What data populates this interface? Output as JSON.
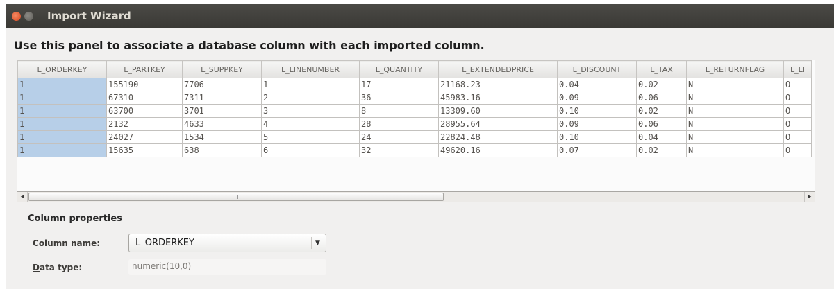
{
  "window": {
    "title": "Import Wizard"
  },
  "instruction": "Use this panel to associate a database column with each imported column.",
  "table": {
    "columns": [
      "L_ORDERKEY",
      "L_PARTKEY",
      "L_SUPPKEY",
      "L_LINENUMBER",
      "L_QUANTITY",
      "L_EXTENDEDPRICE",
      "L_DISCOUNT",
      "L_TAX",
      "L_RETURNFLAG",
      "L_LI"
    ],
    "rows": [
      [
        "1",
        "155190",
        "7706",
        "1",
        "17",
        "21168.23",
        "0.04",
        "0.02",
        "N",
        "O"
      ],
      [
        "1",
        "67310",
        "7311",
        "2",
        "36",
        "45983.16",
        "0.09",
        "0.06",
        "N",
        "O"
      ],
      [
        "1",
        "63700",
        "3701",
        "3",
        "8",
        "13309.60",
        "0.10",
        "0.02",
        "N",
        "O"
      ],
      [
        "1",
        "2132",
        "4633",
        "4",
        "28",
        "28955.64",
        "0.09",
        "0.06",
        "N",
        "O"
      ],
      [
        "1",
        "24027",
        "1534",
        "5",
        "24",
        "22824.48",
        "0.10",
        "0.04",
        "N",
        "O"
      ],
      [
        "1",
        "15635",
        "638",
        "6",
        "32",
        "49620.16",
        "0.07",
        "0.02",
        "N",
        "O"
      ]
    ],
    "selected_column": "L_ORDERKEY"
  },
  "scrollbar": {
    "left_arrow": "◂",
    "right_arrow": "▸"
  },
  "properties": {
    "title": "Column properties",
    "column_name_label_mnemonic": "C",
    "column_name_label_rest": "olumn name:",
    "column_name_value": "L_ORDERKEY",
    "data_type_label_mnemonic": "D",
    "data_type_label_rest": "ata type:",
    "data_type_value": "numeric(10,0)"
  },
  "colors": {
    "titlebar": "#3f3e3a",
    "selected_column": "#b7cfe8",
    "close_button": "#e45a2d"
  },
  "icons": {
    "close": "close-icon",
    "minimize": "minimize-icon",
    "dropdown": "chevron-down-icon"
  }
}
